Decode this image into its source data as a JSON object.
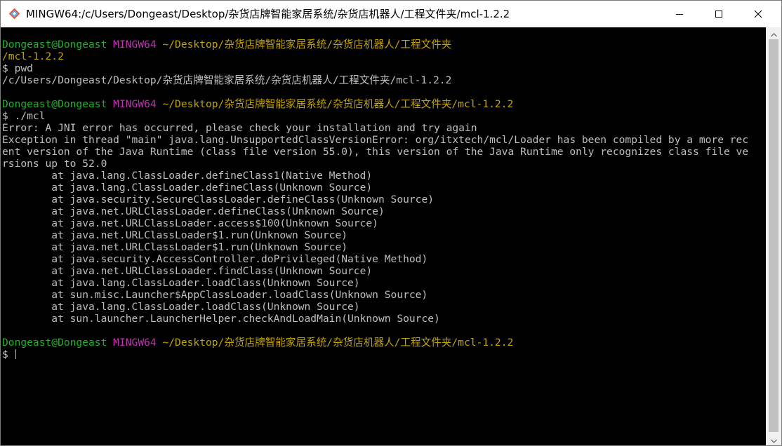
{
  "window": {
    "title": "MINGW64:/c/Users/Dongeast/Desktop/杂货店牌智能家居系统/杂货店机器人/工程文件夹/mcl-1.2.2",
    "icons": {
      "app": "git-bash-icon",
      "minimize": "minimize-icon",
      "maximize": "maximize-icon",
      "close": "close-icon"
    }
  },
  "colors": {
    "background": "#000000",
    "text": "#bfbfbf",
    "user_host": "#1cb329",
    "system": "#c232b2",
    "path": "#c3a300"
  },
  "terminal": {
    "lines": [
      {
        "type": "prompt",
        "user": "Dongeast@Dongeast",
        "system": "MINGW64",
        "path": "~/Desktop/杂货店牌智能家居系统/杂货店机器人/工程文件夹"
      },
      {
        "type": "path",
        "text": "/mcl-1.2.2"
      },
      {
        "type": "text",
        "text": "$ pwd"
      },
      {
        "type": "text",
        "text": "/c/Users/Dongeast/Desktop/杂货店牌智能家居系统/杂货店机器人/工程文件夹/mcl-1.2.2"
      },
      {
        "type": "text",
        "text": ""
      },
      {
        "type": "prompt",
        "user": "Dongeast@Dongeast",
        "system": "MINGW64",
        "path": "~/Desktop/杂货店牌智能家居系统/杂货店机器人/工程文件夹/mcl-1.2.2"
      },
      {
        "type": "text",
        "text": "$ ./mcl"
      },
      {
        "type": "text",
        "text": "Error: A JNI error has occurred, please check your installation and try again"
      },
      {
        "type": "text",
        "text": "Exception in thread \"main\" java.lang.UnsupportedClassVersionError: org/itxtech/mcl/Loader has been compiled by a more rec"
      },
      {
        "type": "text",
        "text": "ent version of the Java Runtime (class file version 55.0), this version of the Java Runtime only recognizes class file ve"
      },
      {
        "type": "text",
        "text": "rsions up to 52.0"
      },
      {
        "type": "text",
        "text": "        at java.lang.ClassLoader.defineClass1(Native Method)"
      },
      {
        "type": "text",
        "text": "        at java.lang.ClassLoader.defineClass(Unknown Source)"
      },
      {
        "type": "text",
        "text": "        at java.security.SecureClassLoader.defineClass(Unknown Source)"
      },
      {
        "type": "text",
        "text": "        at java.net.URLClassLoader.defineClass(Unknown Source)"
      },
      {
        "type": "text",
        "text": "        at java.net.URLClassLoader.access$100(Unknown Source)"
      },
      {
        "type": "text",
        "text": "        at java.net.URLClassLoader$1.run(Unknown Source)"
      },
      {
        "type": "text",
        "text": "        at java.net.URLClassLoader$1.run(Unknown Source)"
      },
      {
        "type": "text",
        "text": "        at java.security.AccessController.doPrivileged(Native Method)"
      },
      {
        "type": "text",
        "text": "        at java.net.URLClassLoader.findClass(Unknown Source)"
      },
      {
        "type": "text",
        "text": "        at java.lang.ClassLoader.loadClass(Unknown Source)"
      },
      {
        "type": "text",
        "text": "        at sun.misc.Launcher$AppClassLoader.loadClass(Unknown Source)"
      },
      {
        "type": "text",
        "text": "        at java.lang.ClassLoader.loadClass(Unknown Source)"
      },
      {
        "type": "text",
        "text": "        at sun.launcher.LauncherHelper.checkAndLoadMain(Unknown Source)"
      },
      {
        "type": "text",
        "text": ""
      },
      {
        "type": "prompt",
        "user": "Dongeast@Dongeast",
        "system": "MINGW64",
        "path": "~/Desktop/杂货店牌智能家居系统/杂货店机器人/工程文件夹/mcl-1.2.2"
      },
      {
        "type": "input",
        "text": "$ "
      }
    ]
  }
}
